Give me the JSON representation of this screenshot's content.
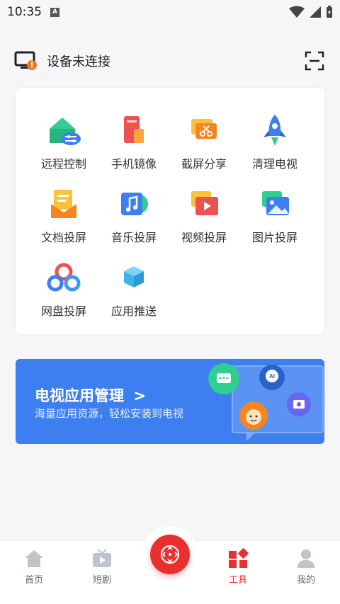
{
  "status": {
    "time": "10:35",
    "notif_icon": "a-icon"
  },
  "device": {
    "label": "设备未连接",
    "icon": "monitor-warning-icon",
    "scan_icon": "scan-icon"
  },
  "tools": [
    {
      "label": "远程控制",
      "icon": "remote-control-icon"
    },
    {
      "label": "手机镜像",
      "icon": "phone-mirror-icon"
    },
    {
      "label": "截屏分享",
      "icon": "screenshot-share-icon"
    },
    {
      "label": "清理电视",
      "icon": "rocket-icon"
    },
    {
      "label": "文档投屏",
      "icon": "document-cast-icon"
    },
    {
      "label": "音乐投屏",
      "icon": "music-cast-icon"
    },
    {
      "label": "视频投屏",
      "icon": "video-cast-icon"
    },
    {
      "label": "图片投屏",
      "icon": "image-cast-icon"
    },
    {
      "label": "网盘投屏",
      "icon": "cloud-drive-icon"
    },
    {
      "label": "应用推送",
      "icon": "app-push-icon"
    }
  ],
  "banner": {
    "title": "电视应用管理",
    "chevron": ">",
    "subtitle": "海量应用资源，轻松安装到电视"
  },
  "tabbar": {
    "items": [
      {
        "label": "首页",
        "icon": "home-icon"
      },
      {
        "label": "短剧",
        "icon": "tv-icon"
      },
      {
        "label": "工具",
        "icon": "tools-grid-icon"
      },
      {
        "label": "我的",
        "icon": "user-icon"
      }
    ],
    "active": "工具",
    "center_icon": "remote-icon"
  },
  "colors": {
    "accent": "#e8312f",
    "banner": "#3d7ef0"
  }
}
